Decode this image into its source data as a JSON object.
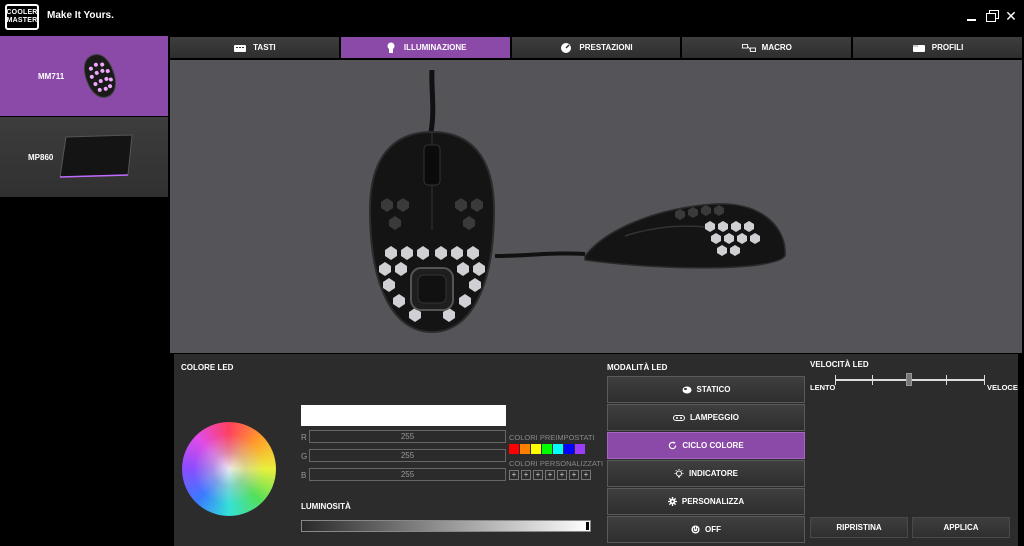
{
  "app": {
    "logo_line1": "COOLER",
    "logo_line2": "MASTER",
    "tagline": "Make It Yours.",
    "window_controls": {
      "close": "✕"
    }
  },
  "sidebar": {
    "devices": [
      {
        "label": "MM711",
        "icon": "mouse-thumbnail",
        "selected": true
      },
      {
        "label": "MP860",
        "icon": "mousepad-thumbnail",
        "selected": false
      }
    ]
  },
  "tabs": [
    {
      "label": "TASTI",
      "icon": "keyboard-icon",
      "active": false
    },
    {
      "label": "ILLUMINAZIONE",
      "icon": "bulb-icon",
      "active": true
    },
    {
      "label": "PRESTAZIONI",
      "icon": "gauge-icon",
      "active": false
    },
    {
      "label": "MACRO",
      "icon": "macro-icon",
      "active": false
    },
    {
      "label": "PROFILI",
      "icon": "profile-icon",
      "active": false
    }
  ],
  "led_color": {
    "title": "COLORE LED",
    "preview_color": "#ffffff",
    "r_label": "R",
    "r_value": "255",
    "g_label": "G",
    "g_value": "255",
    "b_label": "B",
    "b_value": "255",
    "presets_label": "COLORI PREIMPOSTATI",
    "presets": [
      "#ff0000",
      "#ff7f00",
      "#ffff00",
      "#00ff00",
      "#00ffff",
      "#0000ff",
      "#9b3dff"
    ],
    "custom_label": "COLORI PERSONALIZZATI",
    "custom_slots": [
      "+",
      "+",
      "+",
      "+",
      "+",
      "+",
      "+"
    ],
    "brightness_label": "LUMINOSITÀ",
    "brightness_level": 1.0
  },
  "led_modes": {
    "title": "MODALITÀ LED",
    "items": [
      {
        "label": "STATICO",
        "icon": "static-icon",
        "active": false
      },
      {
        "label": "LAMPEGGIO",
        "icon": "breathing-icon",
        "active": false
      },
      {
        "label": "CICLO COLORE",
        "icon": "cycle-icon",
        "active": true
      },
      {
        "label": "INDICATORE",
        "icon": "indicator-icon",
        "active": false
      },
      {
        "label": "PERSONALIZZA",
        "icon": "gear-icon",
        "active": false
      },
      {
        "label": "OFF",
        "icon": "power-icon",
        "active": false
      }
    ]
  },
  "led_speed": {
    "title": "VELOCITÀ LED",
    "slow_label": "LENTO",
    "fast_label": "VELOCE",
    "level": 0.5
  },
  "actions": {
    "reset": "RIPRISTINA",
    "apply": "APPLICA"
  },
  "colors": {
    "accent": "#8c4aa8",
    "panel": "#2c2c2c",
    "preview_bg": "#545459"
  }
}
